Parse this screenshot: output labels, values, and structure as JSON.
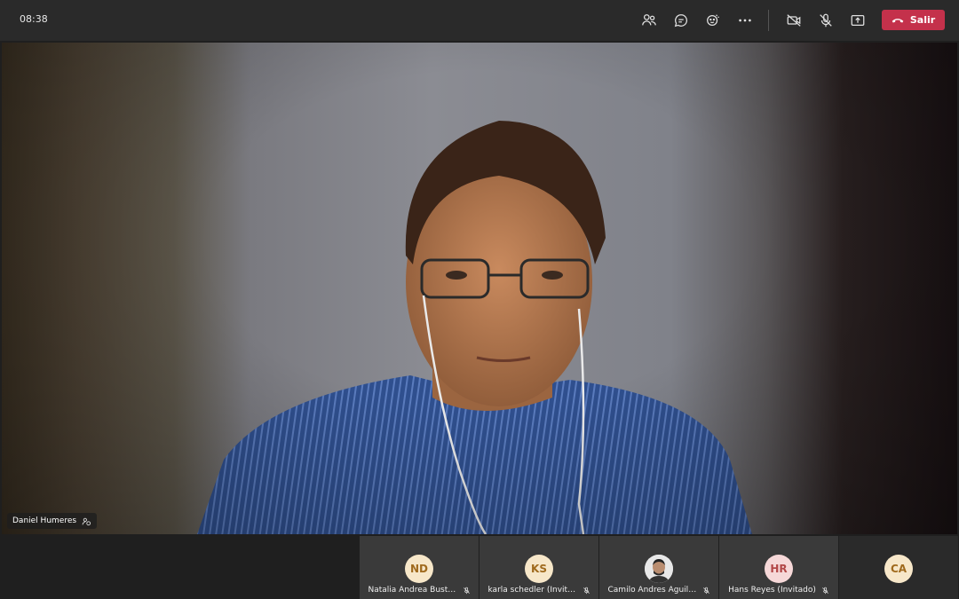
{
  "topbar": {
    "clock": "08:38",
    "leave_label": "Salir",
    "leave_color": "#c4314b"
  },
  "icons": [
    "participants-icon",
    "chat-icon",
    "reactions-icon",
    "more-options-icon",
    "camera-off-icon",
    "mic-off-icon",
    "share-screen-icon",
    "hang-up-icon"
  ],
  "main_video": {
    "speaker_name": "Daniel Humeres"
  },
  "participants": [
    {
      "initials": "ND",
      "name": "Natalia Andrea Bustos...",
      "avatar_color": "#f7e7c9",
      "muted": true
    },
    {
      "initials": "KS",
      "name": "karla schedler (Invitado)",
      "avatar_color": "#f7e7c9",
      "muted": true
    },
    {
      "initials": "",
      "name": "Camilo Andres Aguiler...",
      "avatar_type": "photo",
      "muted": true
    },
    {
      "initials": "HR",
      "name": "Hans Reyes (Invitado)",
      "avatar_color": "#f6d8d8",
      "muted": true
    },
    {
      "initials": "CA",
      "name": "",
      "avatar_color": "#f7e7c9",
      "muted": false
    }
  ]
}
